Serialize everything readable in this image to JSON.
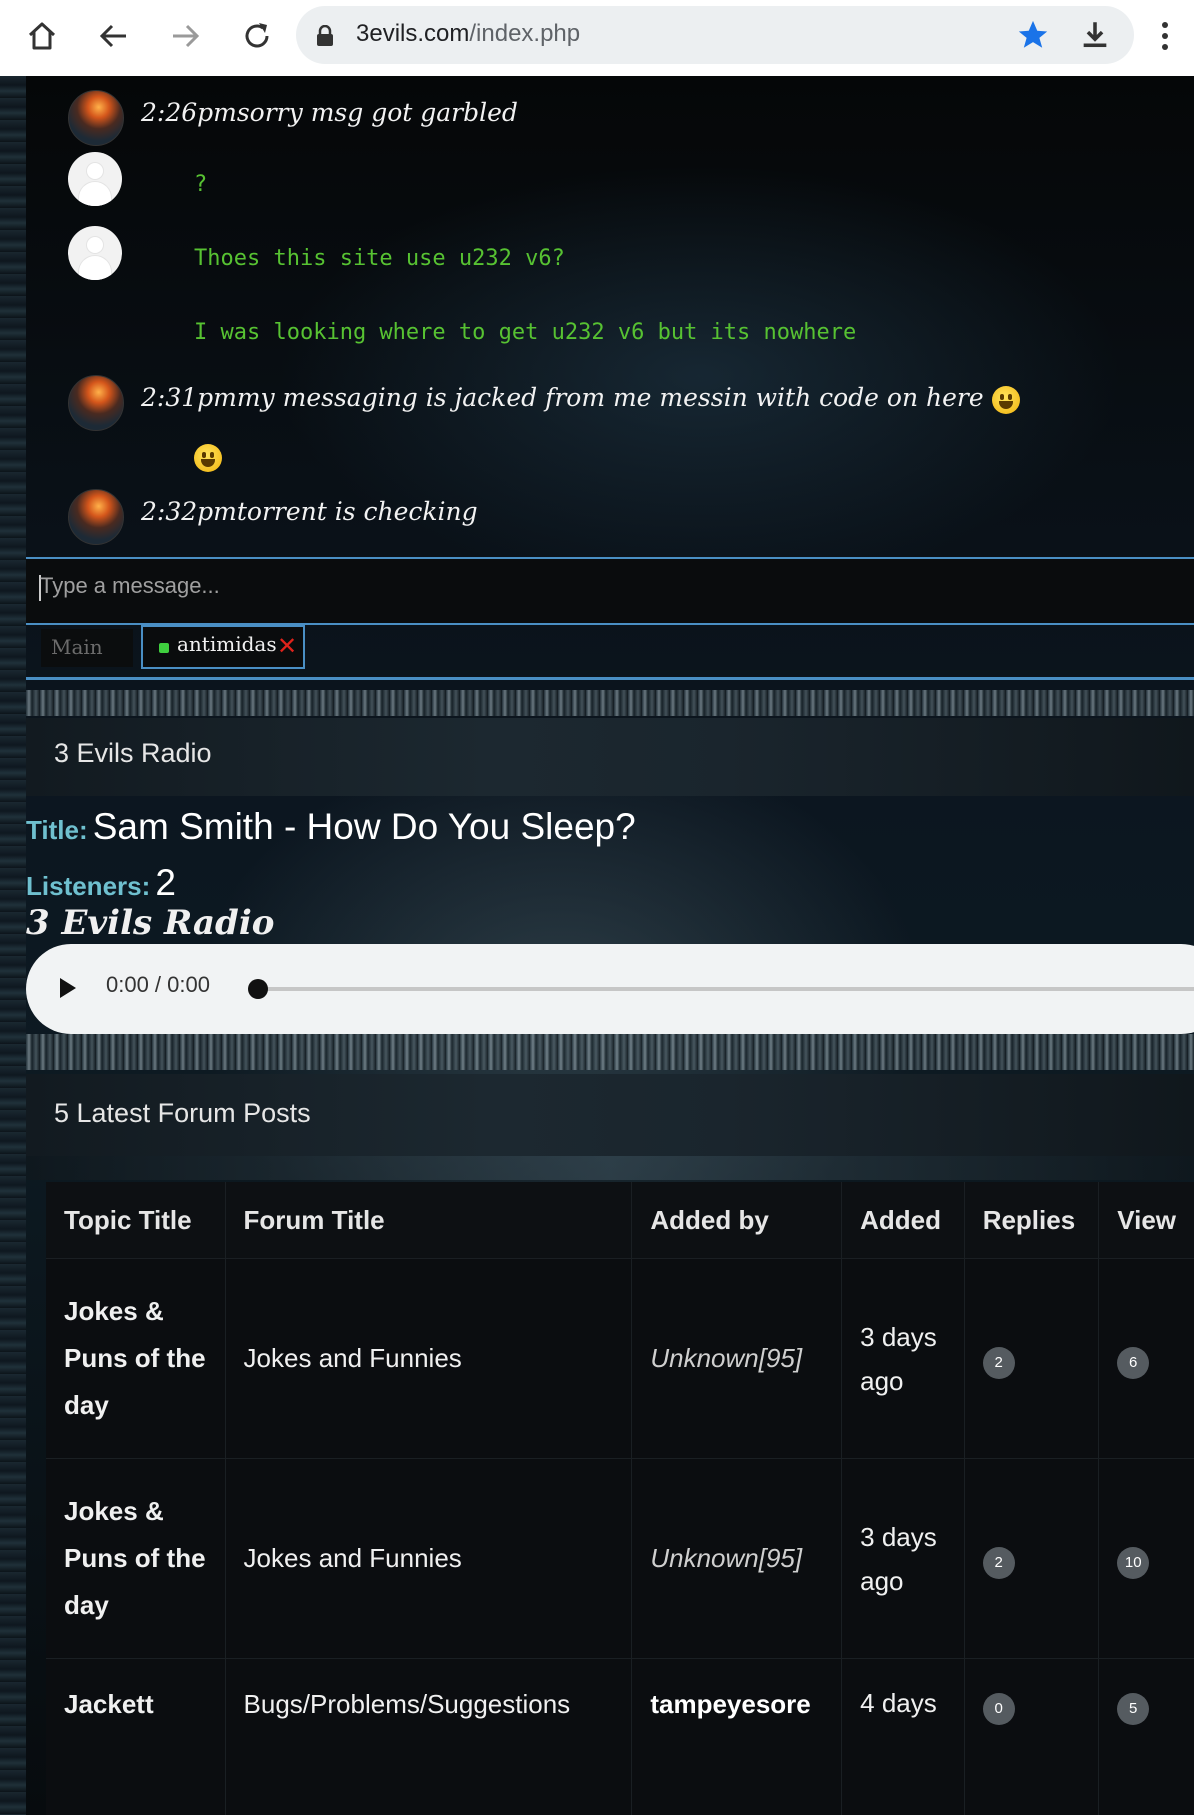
{
  "browser": {
    "url_domain": "3evils.com",
    "url_path": "/index.php"
  },
  "chat": {
    "messages": [
      {
        "kind": "user",
        "text": "2:26pmsorry msg got garbled"
      },
      {
        "kind": "guest",
        "text": "?"
      },
      {
        "kind": "guest",
        "text": "Thoes this site use u232 v6?"
      },
      {
        "kind": "guest",
        "text": "I was looking where to get u232 v6 but its nowhere"
      },
      {
        "kind": "user",
        "text": "2:31pmmy messaging is jacked from me messin with code on here"
      },
      {
        "kind": "emoji",
        "text": ""
      },
      {
        "kind": "user",
        "text": "2:32pmtorrent is checking"
      }
    ],
    "input_placeholder": "Type a message...",
    "tabs": {
      "main": "Main",
      "user": "antimidas",
      "close": "✕"
    }
  },
  "radio": {
    "panel_title": "3 Evils Radio",
    "title_label": "Title:",
    "title_value": "Sam Smith - How Do You Sleep?",
    "listeners_label": "Listeners:",
    "listeners_value": "2",
    "script_heading": "3 Evils Radio",
    "player_time": "0:00 / 0:00"
  },
  "forum": {
    "panel_title": "5 Latest Forum Posts",
    "columns": [
      "Topic Title",
      "Forum Title",
      "Added by",
      "Added",
      "Replies",
      "View"
    ],
    "rows": [
      {
        "topic": "Jokes & Puns of the day",
        "forum": "Jokes and Funnies",
        "by": "Unknown[95]",
        "added": "3 days ago",
        "replies": "2",
        "views": "6"
      },
      {
        "topic": "Jokes & Puns of the day",
        "forum": "Jokes and Funnies",
        "by": "Unknown[95]",
        "added": "3 days ago",
        "replies": "2",
        "views": "10"
      },
      {
        "topic": "Jackett",
        "forum": "Bugs/Problems/Suggestions",
        "by": "tampeyesore",
        "added": "4 days",
        "replies": "0",
        "views": "5"
      }
    ]
  },
  "colors": {
    "accent_blue": "#4a8fc4",
    "chat_green": "#57c232",
    "label_teal": "#6fc0cf",
    "close_red": "#e0231b",
    "star_blue": "#1a73e8"
  }
}
